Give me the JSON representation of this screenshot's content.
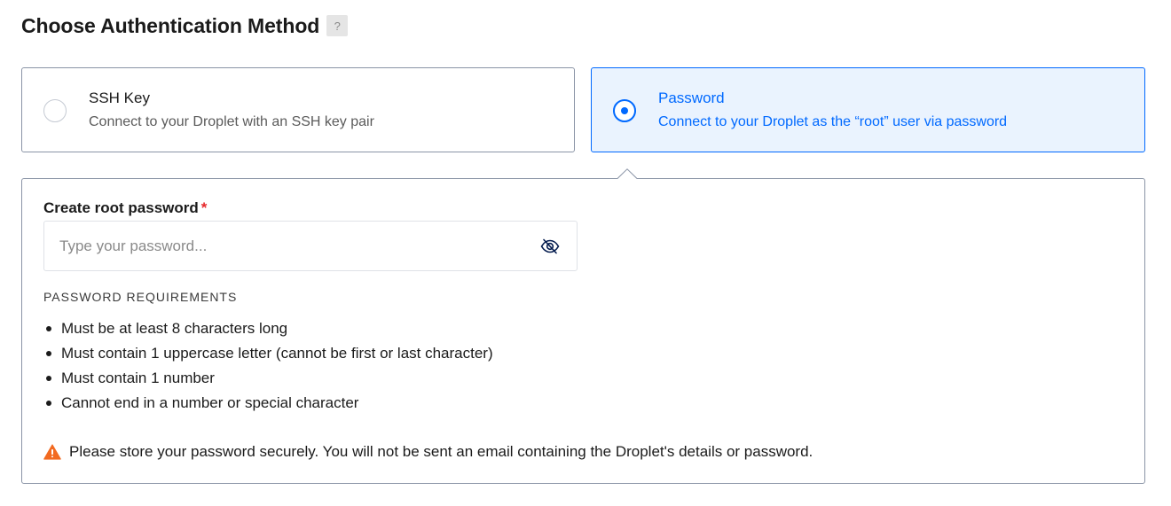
{
  "header": {
    "title": "Choose Authentication Method",
    "help_label": "?"
  },
  "options": [
    {
      "label": "SSH Key",
      "description": "Connect to your Droplet with an SSH key pair",
      "selected": false
    },
    {
      "label": "Password",
      "description": "Connect to your Droplet as the “root” user via password",
      "selected": true
    }
  ],
  "password_panel": {
    "field_label": "Create root password",
    "required_marker": "*",
    "input_placeholder": "Type your password...",
    "input_value": "",
    "visibility_icon": "eye-slash-icon",
    "requirements_heading": "PASSWORD REQUIREMENTS",
    "requirements": [
      "Must be at least 8 characters long",
      "Must contain 1 uppercase letter (cannot be first or last character)",
      "Must contain 1 number",
      "Cannot end in a number or special character"
    ],
    "warning_icon": "warning-triangle-icon",
    "warning_text": "Please store your password securely. You will not be sent an email containing the Droplet's details or password."
  },
  "colors": {
    "accent": "#0069ff",
    "selected_bg": "#eaf3fe",
    "border": "#8a94a6",
    "required": "#e6282b",
    "warning": "#f26a21",
    "text": "#1b1b1b",
    "muted": "#5b5b5b"
  }
}
